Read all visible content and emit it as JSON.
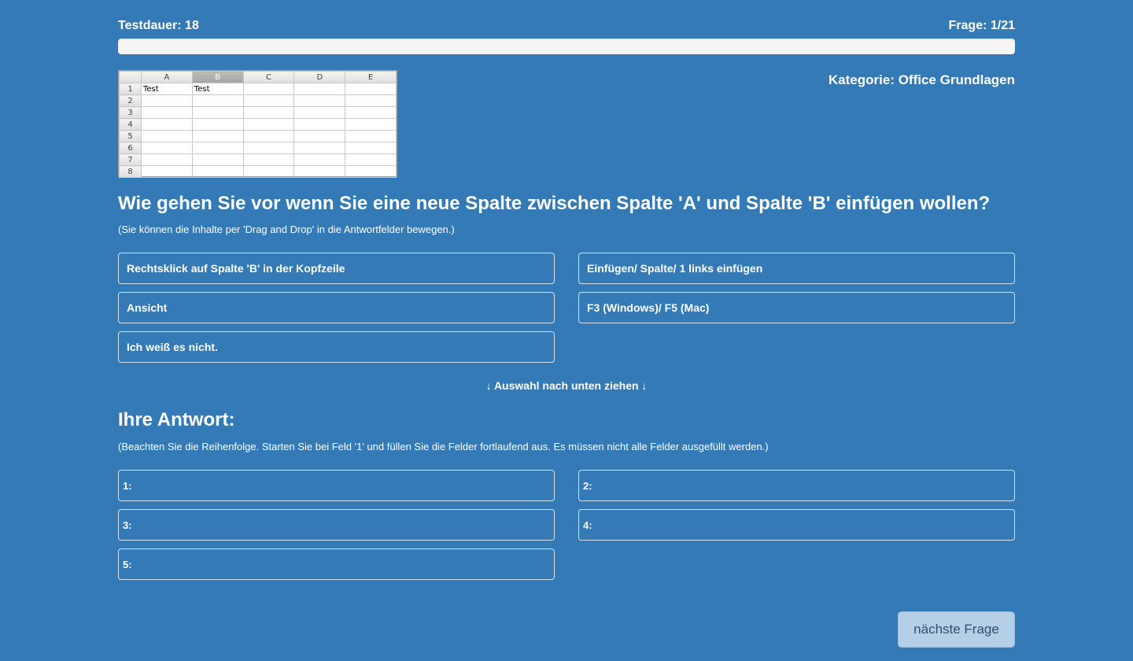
{
  "header": {
    "duration": "Testdauer: 18",
    "question_counter": "Frage: 1/21",
    "progress": 0.0
  },
  "spreadsheet": {
    "columns": [
      "A",
      "B",
      "C",
      "D",
      "E"
    ],
    "rows": [
      "1",
      "2",
      "3",
      "4",
      "5",
      "6",
      "7",
      "8"
    ],
    "cells": {
      "A1": "Test",
      "B1": "Test"
    },
    "selected_column": "B"
  },
  "category": "Kategorie: Office Grundlagen",
  "question": "Wie gehen Sie vor wenn Sie eine neue Spalte zwischen Spalte 'A' und Spalte 'B' einfügen wollen?",
  "question_hint": "(Sie können die Inhalte per 'Drag and Drop' in die Antwortfelder bewegen.)",
  "options": [
    "Rechtsklick auf Spalte 'B' in der Kopfzeile",
    "Einfügen/ Spalte/ 1 links einfügen",
    "Ansicht",
    "F3 (Windows)/ F5 (Mac)",
    "Ich weiß es nicht."
  ],
  "drag_hint": "↓ Auswahl nach unten ziehen ↓",
  "answer": {
    "title": "Ihre Antwort:",
    "hint": "(Beachten Sie die Reihenfolge. Starten Sie bei Feld '1' und füllen Sie die Felder fortlaufend aus. Es müssen nicht alle Felder ausgefüllt werden.)",
    "slots": [
      "1:",
      "2:",
      "3:",
      "4:",
      "5:"
    ]
  },
  "next_button": "nächste Frage",
  "colors": {
    "background": "#337ab7",
    "button": "#b5cfe6"
  }
}
